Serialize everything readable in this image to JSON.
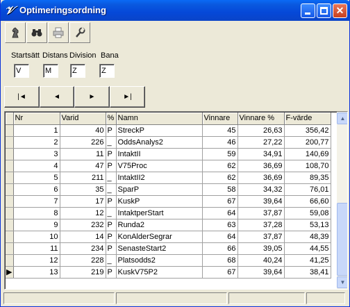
{
  "window": {
    "title": "Optimeringsordning",
    "accent": "#0a5ae0"
  },
  "title_buttons": {
    "minimize": "minimize-icon",
    "maximize": "maximize-icon",
    "close": "close-icon",
    "close_glyph": "✕"
  },
  "toolbar": [
    {
      "icon": "chess-knight-icon"
    },
    {
      "icon": "binoculars-icon"
    },
    {
      "icon": "printer-icon"
    },
    {
      "icon": "tool-icon"
    }
  ],
  "fields": [
    {
      "label": "Startsätt",
      "value": "V"
    },
    {
      "label": "Distans",
      "value": "M"
    },
    {
      "label": "Division",
      "value": "Z"
    },
    {
      "label": "Bana",
      "value": "Z"
    }
  ],
  "nav": [
    {
      "icon": "first-record-icon",
      "glyph": "|◄"
    },
    {
      "icon": "prev-record-icon",
      "glyph": "◄"
    },
    {
      "icon": "next-record-icon",
      "glyph": "►"
    },
    {
      "icon": "last-record-icon",
      "glyph": "►|"
    }
  ],
  "table": {
    "columns": [
      "Nr",
      "Varid",
      "%",
      "Namn",
      "Vinnare",
      "Vinnare %",
      "F-värde"
    ],
    "current_row_index": 12,
    "rows": [
      [
        "1",
        "40",
        "P",
        "StreckP",
        "45",
        "26,63",
        "356,42"
      ],
      [
        "2",
        "226",
        "_",
        "OddsAnalys2",
        "46",
        "27,22",
        "200,77"
      ],
      [
        "3",
        "11",
        "P",
        "IntaktII",
        "59",
        "34,91",
        "140,69"
      ],
      [
        "4",
        "47",
        "P",
        "V75Proc",
        "62",
        "36,69",
        "108,70"
      ],
      [
        "5",
        "211",
        "_",
        "IntaktII2",
        "62",
        "36,69",
        "89,35"
      ],
      [
        "6",
        "35",
        "_",
        "SparP",
        "58",
        "34,32",
        "76,01"
      ],
      [
        "7",
        "17",
        "P",
        "KuskP",
        "67",
        "39,64",
        "66,60"
      ],
      [
        "8",
        "12",
        "_",
        "IntaktperStart",
        "64",
        "37,87",
        "59,08"
      ],
      [
        "9",
        "232",
        "P",
        "Runda2",
        "63",
        "37,28",
        "53,13"
      ],
      [
        "10",
        "14",
        "P",
        "KonAlderSegrar",
        "64",
        "37,87",
        "48,39"
      ],
      [
        "11",
        "234",
        "P",
        "SenasteStart2",
        "66",
        "39,05",
        "44,55"
      ],
      [
        "12",
        "228",
        "_",
        "Platsodds2",
        "68",
        "40,24",
        "41,25"
      ],
      [
        "13",
        "219",
        "P",
        "KuskV75P2",
        "67",
        "39,64",
        "38,41"
      ]
    ]
  },
  "scrollbar": {
    "up_glyph": "▲",
    "down_glyph": "▼"
  },
  "row_indicator_glyph": "▶"
}
